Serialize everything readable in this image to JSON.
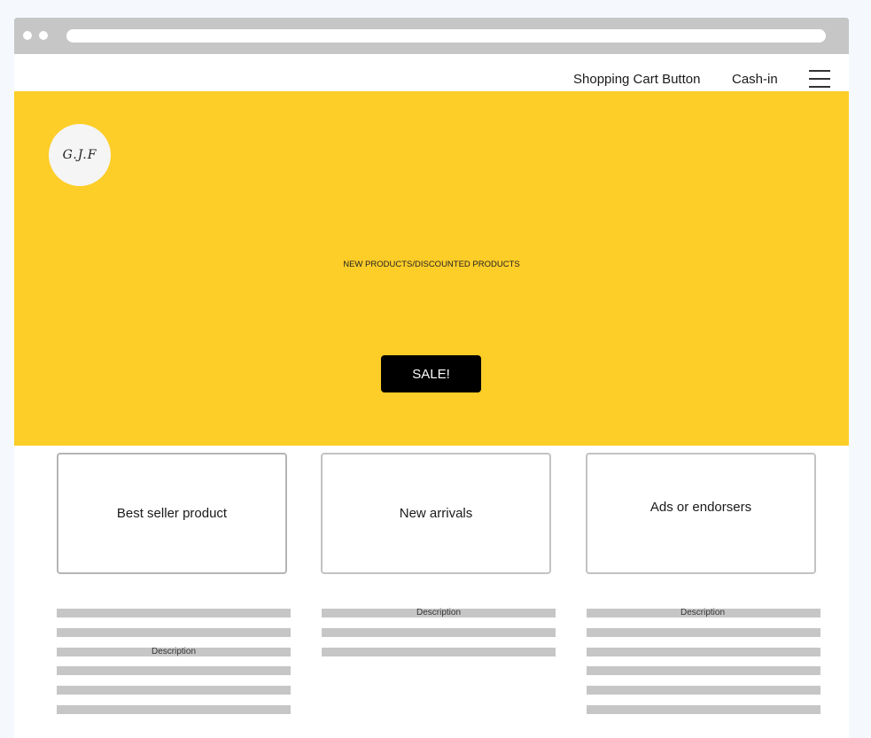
{
  "nav": {
    "cart_label": "Shopping Cart Button",
    "cashin_label": "Cash-in"
  },
  "hero": {
    "logo_text": "G.J.F",
    "headline": "NEW PRODUCTS/DISCOUNTED PRODUCTS",
    "cta_label": "SALE!",
    "background_color": "#fdcd28"
  },
  "cards": [
    {
      "title": "Best seller product",
      "description_label": "Description"
    },
    {
      "title": "New arrivals",
      "description_label": "Description"
    },
    {
      "title": "Ads or endorsers",
      "description_label": "Description"
    }
  ]
}
